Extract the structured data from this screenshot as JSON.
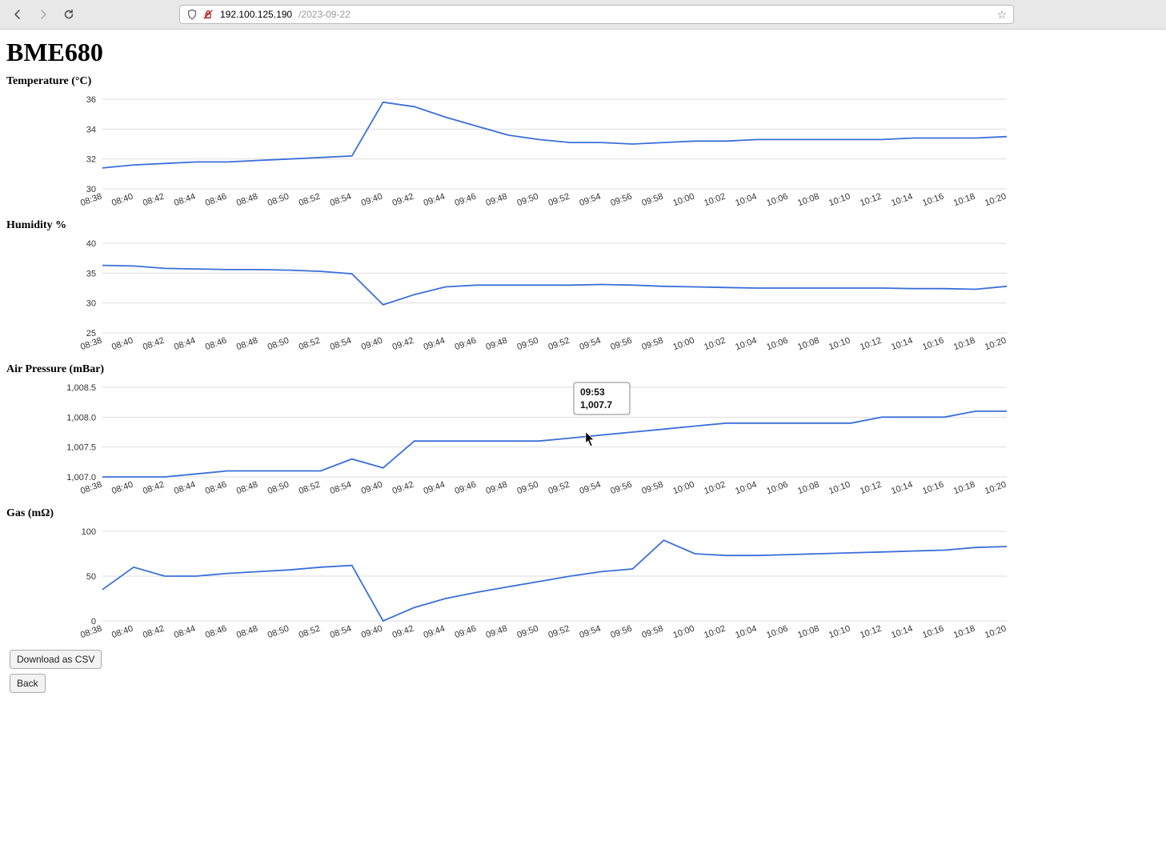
{
  "browser": {
    "url_host": "192.100.125.190",
    "url_path": "/2023-09-22"
  },
  "page_title": "BME680",
  "buttons": {
    "download_csv": "Download as CSV",
    "back": "Back"
  },
  "hover_tooltip": {
    "time": "09:53",
    "value": "1,007.7"
  },
  "categories": [
    "08:38",
    "08:40",
    "08:42",
    "08:44",
    "08:46",
    "08:48",
    "08:50",
    "08:52",
    "08:54",
    "09:40",
    "09:42",
    "09:44",
    "09:46",
    "09:48",
    "09:50",
    "09:52",
    "09:54",
    "09:56",
    "09:58",
    "10:00",
    "10:02",
    "10:04",
    "10:06",
    "10:08",
    "10:10",
    "10:12",
    "10:14",
    "10:16",
    "10:18",
    "10:20"
  ],
  "chart_data": [
    {
      "type": "line",
      "title": "Temperature (°C)",
      "categories": [
        "08:38",
        "08:40",
        "08:42",
        "08:44",
        "08:46",
        "08:48",
        "08:50",
        "08:52",
        "08:54",
        "09:40",
        "09:42",
        "09:44",
        "09:46",
        "09:48",
        "09:50",
        "09:52",
        "09:54",
        "09:56",
        "09:58",
        "10:00",
        "10:02",
        "10:04",
        "10:06",
        "10:08",
        "10:10",
        "10:12",
        "10:14",
        "10:16",
        "10:18",
        "10:20"
      ],
      "values": [
        31.4,
        31.6,
        31.7,
        31.8,
        31.8,
        31.9,
        32.0,
        32.1,
        32.2,
        35.8,
        35.5,
        34.8,
        34.2,
        33.6,
        33.3,
        33.1,
        33.1,
        33.0,
        33.1,
        33.2,
        33.2,
        33.3,
        33.3,
        33.3,
        33.3,
        33.3,
        33.4,
        33.4,
        33.4,
        33.5
      ],
      "ylabel": "",
      "xlabel": "",
      "ylim": [
        30,
        36
      ],
      "yticks": [
        30,
        32,
        34,
        36
      ]
    },
    {
      "type": "line",
      "title": "Humidity %",
      "categories": [
        "08:38",
        "08:40",
        "08:42",
        "08:44",
        "08:46",
        "08:48",
        "08:50",
        "08:52",
        "08:54",
        "09:40",
        "09:42",
        "09:44",
        "09:46",
        "09:48",
        "09:50",
        "09:52",
        "09:54",
        "09:56",
        "09:58",
        "10:00",
        "10:02",
        "10:04",
        "10:06",
        "10:08",
        "10:10",
        "10:12",
        "10:14",
        "10:16",
        "10:18",
        "10:20"
      ],
      "values": [
        36.3,
        36.2,
        35.8,
        35.7,
        35.6,
        35.6,
        35.5,
        35.3,
        34.9,
        29.7,
        31.4,
        32.7,
        33.0,
        33.0,
        33.0,
        33.0,
        33.1,
        33.0,
        32.8,
        32.7,
        32.6,
        32.5,
        32.5,
        32.5,
        32.5,
        32.5,
        32.4,
        32.4,
        32.3,
        32.8
      ],
      "ylabel": "",
      "xlabel": "",
      "ylim": [
        25,
        40
      ],
      "yticks": [
        25,
        30,
        35,
        40
      ]
    },
    {
      "type": "line",
      "title": "Air Pressure (mBar)",
      "categories": [
        "08:38",
        "08:40",
        "08:42",
        "08:44",
        "08:46",
        "08:48",
        "08:50",
        "08:52",
        "08:54",
        "09:40",
        "09:42",
        "09:44",
        "09:46",
        "09:48",
        "09:50",
        "09:52",
        "09:54",
        "09:56",
        "09:58",
        "10:00",
        "10:02",
        "10:04",
        "10:06",
        "10:08",
        "10:10",
        "10:12",
        "10:14",
        "10:16",
        "10:18",
        "10:20"
      ],
      "values": [
        1007.0,
        1007.0,
        1007.0,
        1007.05,
        1007.1,
        1007.1,
        1007.1,
        1007.1,
        1007.3,
        1007.15,
        1007.6,
        1007.6,
        1007.6,
        1007.6,
        1007.6,
        1007.65,
        1007.7,
        1007.75,
        1007.8,
        1007.85,
        1007.9,
        1007.9,
        1007.9,
        1007.9,
        1007.9,
        1008.0,
        1008.0,
        1008.0,
        1008.1,
        1008.1
      ],
      "ylabel": "",
      "xlabel": "",
      "ylim": [
        1007.0,
        1008.5
      ],
      "yticks": [
        1007.0,
        1007.5,
        1008.0,
        1008.5
      ],
      "tick_format": "comma1"
    },
    {
      "type": "line",
      "title": "Gas (mΩ)",
      "categories": [
        "08:38",
        "08:40",
        "08:42",
        "08:44",
        "08:46",
        "08:48",
        "08:50",
        "08:52",
        "08:54",
        "09:40",
        "09:42",
        "09:44",
        "09:46",
        "09:48",
        "09:50",
        "09:52",
        "09:54",
        "09:56",
        "09:58",
        "10:00",
        "10:02",
        "10:04",
        "10:06",
        "10:08",
        "10:10",
        "10:12",
        "10:14",
        "10:16",
        "10:18",
        "10:20"
      ],
      "values": [
        35,
        60,
        50,
        50,
        53,
        55,
        57,
        60,
        62,
        0,
        15,
        25,
        32,
        38,
        44,
        50,
        55,
        58,
        90,
        75,
        73,
        73,
        74,
        75,
        76,
        77,
        78,
        79,
        82,
        83
      ],
      "ylabel": "",
      "xlabel": "",
      "ylim": [
        0,
        100
      ],
      "yticks": [
        0,
        50,
        100
      ]
    }
  ]
}
